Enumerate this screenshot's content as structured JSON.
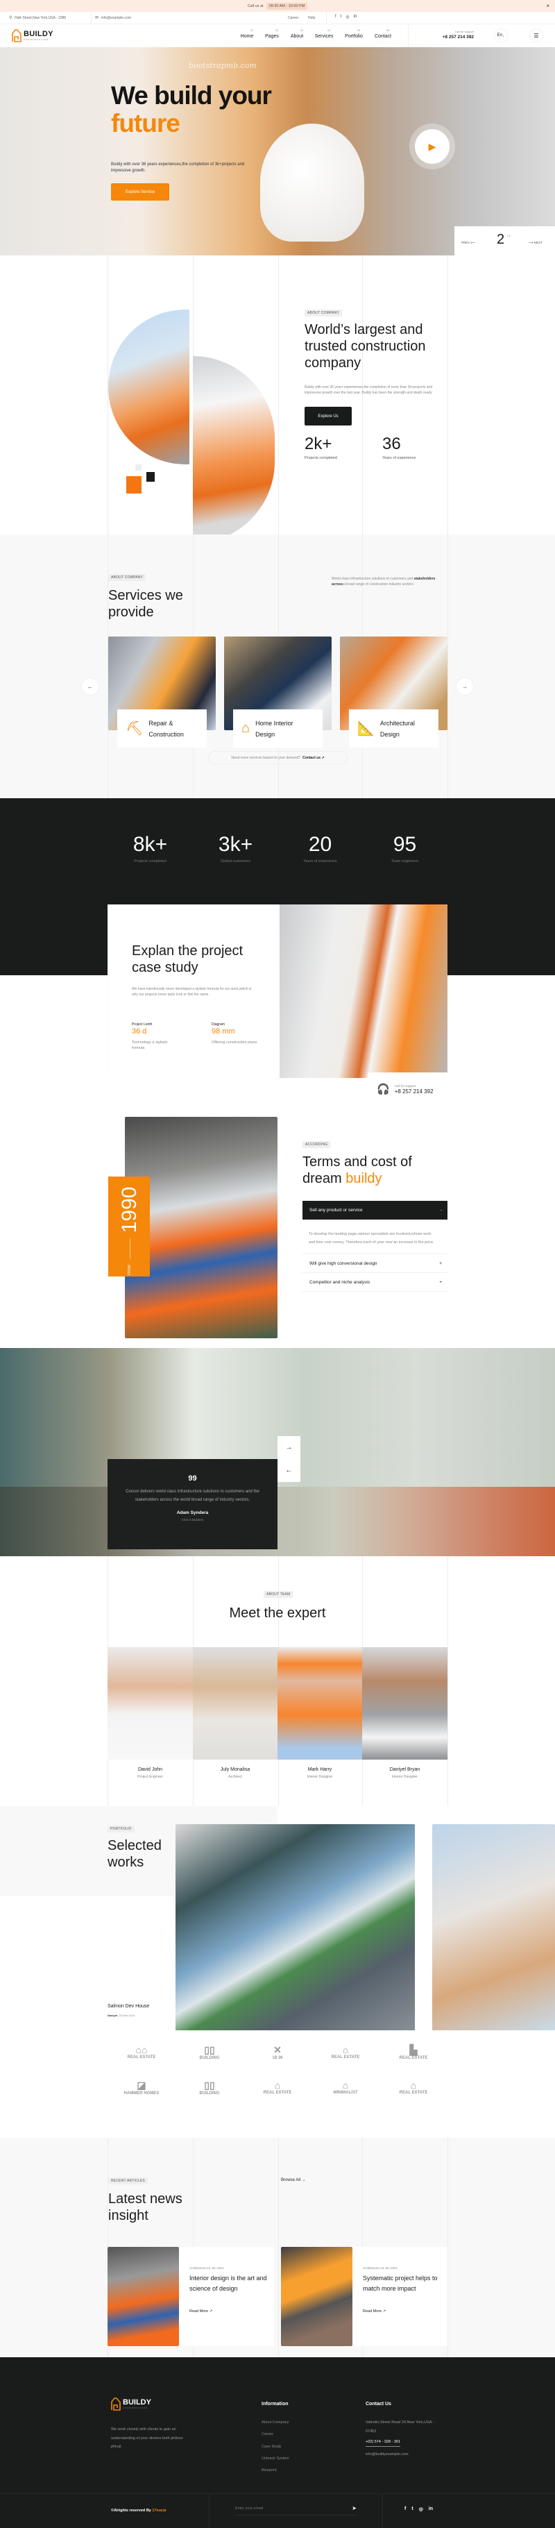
{
  "colors": {
    "accent": "#f5870a",
    "dark": "#1a1b1b",
    "announce_bg": "#fdece2"
  },
  "announce": {
    "label": "Call us at",
    "hours": "09:30 AM - 10:00 PM",
    "close": "×"
  },
  "infobar": {
    "address": "Halk Street,New York,USA - 2386",
    "email": "info@example.com",
    "links": [
      "Career",
      "Help"
    ],
    "social": [
      "facebook-icon",
      "twitter-icon",
      "instagram-icon",
      "linkedin-icon"
    ]
  },
  "nav": {
    "logo": "BUILDY",
    "logo_sub": "CONSTRUCTION",
    "items": [
      {
        "num": "01",
        "label": "Home"
      },
      {
        "num": "02",
        "label": "Pages"
      },
      {
        "num": "03",
        "label": "About"
      },
      {
        "num": "04",
        "label": "Services"
      },
      {
        "num": "05",
        "label": "Portfolio"
      },
      {
        "num": "06",
        "label": "Contact"
      }
    ],
    "support_label": "Call for support",
    "support_phone": "+8 257 214 392",
    "lang": "En"
  },
  "hero": {
    "watermark": "bootstrapmb.com",
    "title_1": "We build your",
    "title_2": "future",
    "text": "Buildy with over 36 years experiences,the completion of 3k+projects and impressive growth.",
    "cta": "Explore Service",
    "slide_current": "2",
    "slide_total": "/ 3",
    "prev": "PREV",
    "next": "NEXT"
  },
  "about": {
    "tag": "ABOUT COMPANY",
    "title": "World’s largest and trusted construction company",
    "text": "Buildy with over 36 years experiences,the completion of more than 3k+projects and impressive growth over the last year. Buildy has been the strength and depth ready.",
    "cta": "Explore Us",
    "stats": [
      {
        "value": "2k+",
        "label": "Projects completed"
      },
      {
        "value": "36",
        "label": "Years of experience"
      }
    ]
  },
  "services": {
    "tag": "ABOUT COMPANY",
    "title": "Services we provide",
    "desc_bold": "stakeholders across",
    "desc_1": "World class infrastructure solutions to customers and ",
    "desc_2": "a broad range of construction industry sectors.",
    "cards": [
      {
        "label": "Repair & Construction",
        "icon": "excavator-icon"
      },
      {
        "label": "Home Interior Design",
        "icon": "interior-icon"
      },
      {
        "label": "Architectural Design",
        "icon": "blueprint-icon"
      }
    ],
    "more_text": "Need more services based on your demand?",
    "more_link": "Contact us ↗"
  },
  "stats": [
    {
      "value": "8k+",
      "label": "Projects completed"
    },
    {
      "value": "3k+",
      "label": "Global customers"
    },
    {
      "value": "20",
      "label": "Years of experience"
    },
    {
      "value": "95",
      "label": "Team engineers"
    }
  ],
  "case": {
    "title": "Explan the project case study",
    "text": "We have intentionally never developed a stylistic formula for our work,which is why our projects never quite look or feel the same.",
    "facts": [
      {
        "label": "Project Lenth",
        "value": "36 d",
        "desc": "Technology a stylistic formula"
      },
      {
        "label": "Diagram",
        "value": "98 mm",
        "desc": "Offering construction plans"
      }
    ],
    "support_label": "Call for support",
    "support_phone": "+8 257 214 392"
  },
  "terms": {
    "from": "FROM",
    "year": "1990",
    "tag": "ACCORDING",
    "title_1": "Terms and cost of dream ",
    "title_2": "buildy",
    "accordion": [
      {
        "q": "Sell any product or service",
        "open": true,
        "a": "To develop the landing page,various specialists are involved,whose work and time cost money. Therefore,each of your new an increase in the price.",
        "sign": "-"
      },
      {
        "q": "Will give high conversional design",
        "open": false,
        "sign": "+"
      },
      {
        "q": "Competitor and niche analysis",
        "open": false,
        "sign": "+"
      }
    ]
  },
  "testimonial": {
    "quote_mark": "99",
    "text": "Concor delivers world class infrastructure solutions to customers and the stakeholders across the world broad range of industry sectors.",
    "name": "Adam Syndera",
    "role": "CEO,S Builders",
    "next": "→",
    "prev": "←"
  },
  "team": {
    "tag": "ABOUT TEAM",
    "title": "Meet the expert",
    "members": [
      {
        "name": "David John",
        "role": "Project Engineer"
      },
      {
        "name": "July Monalisa",
        "role": "Architect"
      },
      {
        "name": "Mark Harry",
        "role": "Interior Designer"
      },
      {
        "name": "Daniyel Bryan",
        "role": "Interior Designer"
      }
    ]
  },
  "works": {
    "tag": "PORTFOLIO",
    "title": "Selected works",
    "item_title": "Salmon Dev House",
    "item_author": "Daniyel",
    "item_date": "- 03 Mar 2019"
  },
  "logos": [
    "REAL ESTATE",
    "BUILDING",
    "18 36",
    "REAL ESTATE",
    "REAL ESTATE",
    "HAMMER HOMES",
    "BUILDING",
    "REAL ESTATE",
    "MINIMALIST",
    "REAL ESTATE"
  ],
  "news": {
    "tag": "RECENT ARTICLES",
    "title": "Latest news insight",
    "browse": "Browse All →",
    "articles": [
      {
        "meta": "Architecture,13 Jun 2021",
        "title": "Interior design is the art and science of design",
        "link": "Read More ↗"
      },
      {
        "meta": "Architecture,13 Jun 2021",
        "title": "Systematic project helps to match more impact",
        "link": "Read More ↗"
      }
    ]
  },
  "footer": {
    "logo": "BUILDY",
    "logo_sub": "CONSTRUCTION",
    "about": "We work closely with clients to gain an understanding of your desires both philoso phical.",
    "info_title": "Information",
    "info_links": [
      "About Company",
      "Career",
      "Case Study",
      "Unloack System",
      "Blueprint"
    ],
    "contact_title": "Contact Us",
    "address": "Valentin,Street Road 24,New York,USA - 67452",
    "phone": "+02) 574 - 328 - 301",
    "email": "info@buildyexample.com",
    "copyright": "©Alrights reserved By ",
    "copyright_brand": "17sucai",
    "email_placeholder": "Enter your email",
    "social": [
      "facebook-icon",
      "twitter-icon",
      "instagram-icon",
      "linkedin-icon"
    ]
  }
}
